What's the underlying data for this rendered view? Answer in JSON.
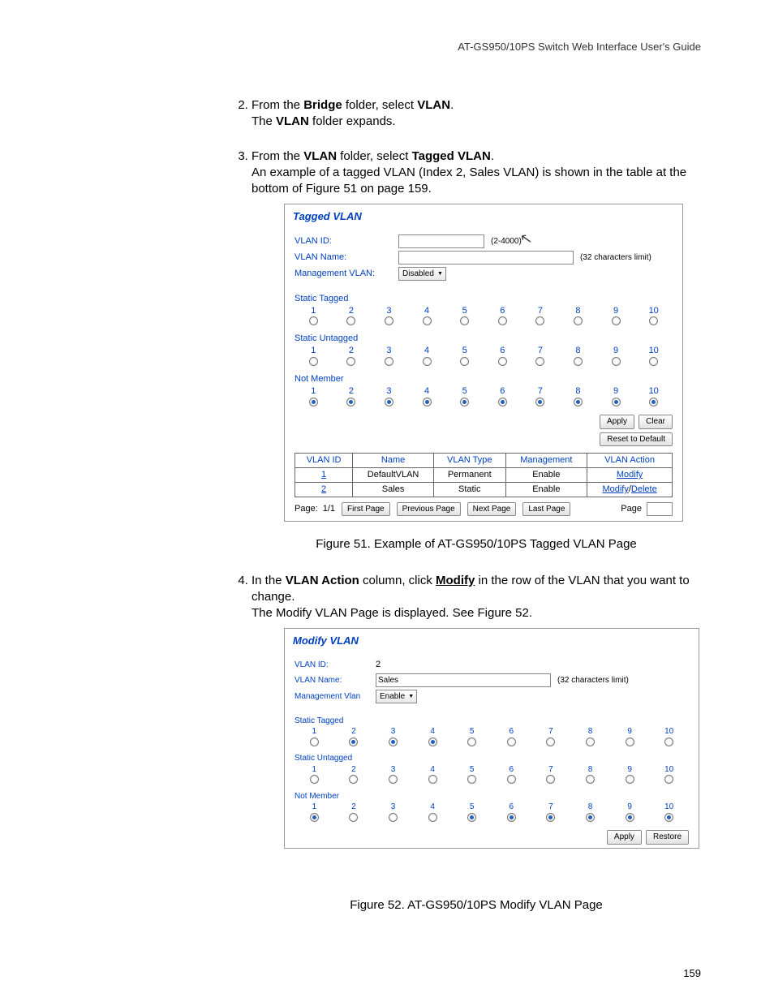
{
  "header": "AT-GS950/10PS Switch Web Interface User's Guide",
  "steps": {
    "s2a": "From the ",
    "s2b": "Bridge",
    "s2c": " folder, select ",
    "s2d": "VLAN",
    "s2e": ".",
    "s2f": "The ",
    "s2g": "VLAN",
    "s2h": " folder expands.",
    "s3a": "From the ",
    "s3b": "VLAN",
    "s3c": " folder, select ",
    "s3d": "Tagged VLAN",
    "s3e": ".",
    "s3f": "An example of a tagged VLAN (Index 2, Sales VLAN) is shown in the table at the bottom of Figure 51 on page 159.",
    "s4a": "In the ",
    "s4b": "VLAN Action",
    "s4c": " column, click ",
    "s4d": "Modify",
    "s4e": " in the row of the VLAN that you want to change.",
    "s4f": "The Modify VLAN Page is displayed. See Figure 52."
  },
  "fig51": "Figure 51. Example of AT-GS950/10PS Tagged VLAN Page",
  "fig52": "Figure 52. AT-GS950/10PS Modify VLAN Page",
  "page_num": "159",
  "shot1": {
    "title": "Tagged VLAN",
    "vlanid_lbl": "VLAN ID:",
    "vlanid_range": "(2-4000)",
    "vlanname_lbl": "VLAN Name:",
    "vlanname_note": "(32 characters limit)",
    "mgmt_lbl": "Management VLAN:",
    "mgmt_val": "Disabled",
    "groups": {
      "tagged": "Static Tagged",
      "untagged": "Static Untagged",
      "notmember": "Not Member"
    },
    "ports": [
      "1",
      "2",
      "3",
      "4",
      "5",
      "6",
      "7",
      "8",
      "9",
      "10"
    ],
    "apply": "Apply",
    "clear": "Clear",
    "reset": "Reset to Default",
    "table": {
      "h": [
        "VLAN ID",
        "Name",
        "VLAN Type",
        "Management",
        "VLAN Action"
      ],
      "r1": {
        "id": "1",
        "name": "DefaultVLAN",
        "type": "Permanent",
        "mgmt": "Enable",
        "act": "Modify"
      },
      "r2": {
        "id": "2",
        "name": "Sales",
        "type": "Static",
        "mgmt": "Enable",
        "act1": "Modify",
        "act_sep": "/",
        "act2": "Delete"
      }
    },
    "pager": {
      "page_lbl": "Page:",
      "page_val": "1/1",
      "first": "First Page",
      "prev": "Previous Page",
      "next": "Next Page",
      "last": "Last Page",
      "page_word": "Page"
    }
  },
  "shot2": {
    "title": "Modify VLAN",
    "vlanid_lbl": "VLAN ID:",
    "vlanid_val": "2",
    "vlanname_lbl": "VLAN Name:",
    "vlanname_val": "Sales",
    "vlanname_note": "(32 characters limit)",
    "mgmt_lbl": "Management Vlan",
    "mgmt_val": "Enable",
    "groups": {
      "tagged": "Static Tagged",
      "untagged": "Static Untagged",
      "notmember": "Not Member"
    },
    "ports": [
      "1",
      "2",
      "3",
      "4",
      "5",
      "6",
      "7",
      "8",
      "9",
      "10"
    ],
    "sel_tagged": [
      false,
      true,
      true,
      true,
      false,
      false,
      false,
      false,
      false,
      false
    ],
    "sel_untagged": [
      false,
      false,
      false,
      false,
      false,
      false,
      false,
      false,
      false,
      false
    ],
    "sel_notmember": [
      true,
      false,
      false,
      false,
      true,
      true,
      true,
      true,
      true,
      true
    ],
    "apply": "Apply",
    "restore": "Restore"
  }
}
